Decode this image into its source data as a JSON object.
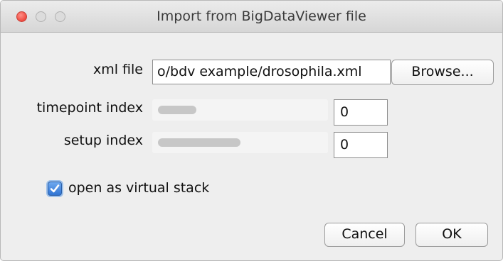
{
  "window": {
    "title": "Import from BigDataViewer file"
  },
  "form": {
    "xml_file_label": "xml file",
    "xml_file_value": "o/bdv example/drosophila.xml",
    "browse_label": "Browse...",
    "timepoint_label": "timepoint index",
    "timepoint_value": "0",
    "timepoint_slider_level": 0.25,
    "setup_label": "setup index",
    "setup_value": "0",
    "setup_slider_level": 0.5,
    "virtual_stack_label": "open as virtual stack",
    "virtual_stack_checked": true,
    "checkmark": "✓"
  },
  "buttons": {
    "cancel": "Cancel",
    "ok": "OK"
  },
  "colors": {
    "accent": "#3d84e0",
    "close_light": "#ee4b40"
  }
}
